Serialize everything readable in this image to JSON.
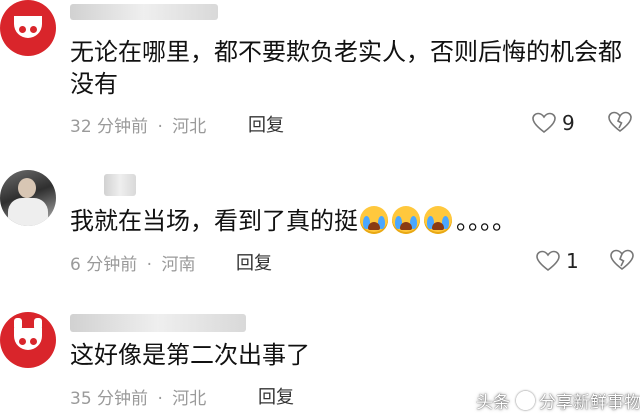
{
  "comments": [
    {
      "text_line1": "无论在哪里，都不要欺负老实人，否则后悔的机会都",
      "text_line2": "没有",
      "time": "32 分钟前",
      "location": "河北",
      "reply_label": "回复",
      "likes": "9"
    },
    {
      "text": "我就在当场，看到了真的挺",
      "text_suffix": "。。。。",
      "time": "6 分钟前",
      "location": "河南",
      "reply_label": "回复",
      "likes": "1"
    },
    {
      "text": "这好像是第二次出事了",
      "time": "35 分钟前",
      "location": "河北",
      "reply_label": "回复"
    }
  ],
  "separator": "·",
  "watermark": {
    "platform": "头条",
    "account": "分享新鲜事物"
  },
  "colors": {
    "avatar_red": "#d9252b",
    "meta_gray": "#9a9a9a",
    "text": "#111111"
  },
  "icons": [
    "heart-outline-icon",
    "broken-heart-icon",
    "crying-face-emoji"
  ]
}
